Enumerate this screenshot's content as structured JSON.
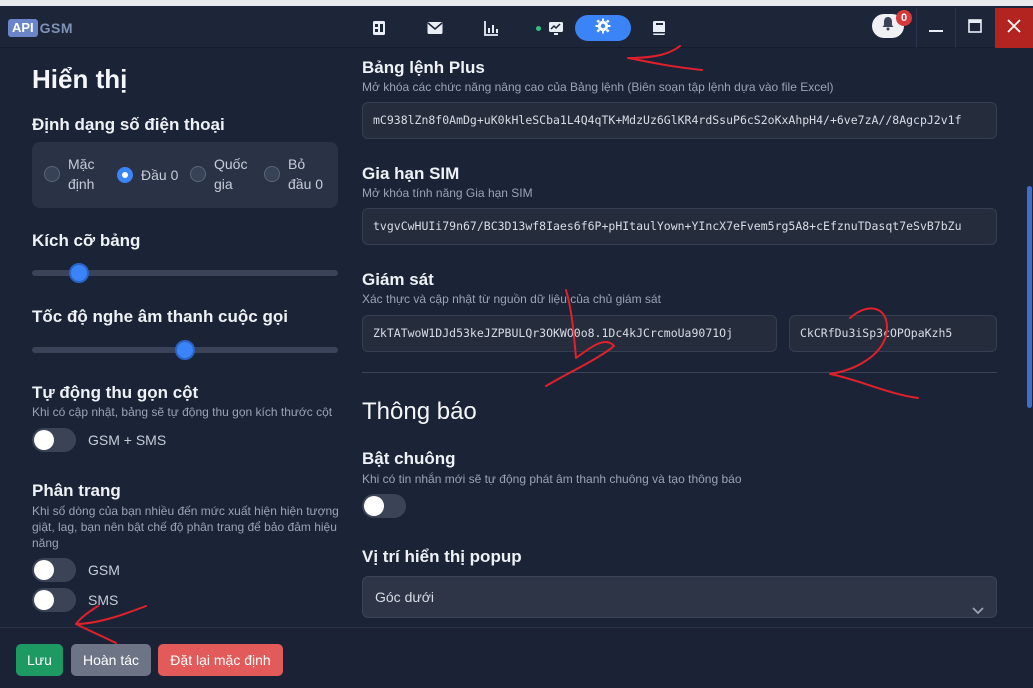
{
  "app": {
    "logo_api": "API",
    "logo_gsm": "GSM",
    "notification_count": "0"
  },
  "nav_icons": [
    "book-icon",
    "mail-icon",
    "chart-icon",
    "monitor-icon",
    "gear-icon",
    "notebook-icon"
  ],
  "sidebar": {
    "title": "Hiển thị",
    "phone_format": {
      "label": "Định dạng số điện thoại",
      "options": [
        {
          "line1": "Mặc",
          "line2": "định"
        },
        {
          "line1": "Đầu 0",
          "line2": ""
        },
        {
          "line1": "Quốc",
          "line2": "gia"
        },
        {
          "line1": "Bỏ",
          "line2": "đầu 0"
        }
      ],
      "selected": "Đầu 0"
    },
    "table_size": {
      "label": "Kích cỡ bảng",
      "level": 0.155
    },
    "call_speed": {
      "label": "Tốc độ nghe âm thanh cuộc gọi",
      "level": 0.5
    },
    "auto_collapse": {
      "label": "Tự động thu gọn cột",
      "desc": "Khi có cập nhật, bảng sẽ tự động thu gọn kích thước cột",
      "toggle_label": "GSM + SMS",
      "on": false
    },
    "pagination": {
      "label": "Phân trang",
      "desc1": "Khi số dòng của bạn nhiều đến mức xuất hiện hiện tượng",
      "desc2": "giật, lag, bạn nên bật chế độ phân trang để bảo đảm hiệu",
      "desc3": "năng",
      "toggles": [
        {
          "label": "GSM",
          "on": false
        },
        {
          "label": "SMS",
          "on": false
        }
      ]
    }
  },
  "main": {
    "command_plus": {
      "title": "Bảng lệnh Plus",
      "desc": "Mở khóa các chức năng nâng cao của Bảng lệnh (Biên soạn tập lệnh dựa vào file Excel)",
      "key": "mC938lZn8f0AmDg+uK0kHleSCba1L4Q4qTK+MdzUz6GlKR4rdSsuP6cS2oKxAhpH4/+6ve7zA//8AgcpJ2v1f"
    },
    "sim_extension": {
      "title": "Gia hạn SIM",
      "desc": "Mở khóa tính năng Gia hạn SIM",
      "key": "tvgvCwHUIi79n67/BC3D13wf8Iaes6f6P+pHItaulYown+YIncX7eFvem5rg5A8+cEfznuTDasqt7eSvB7bZu"
    },
    "monitoring": {
      "title": "Giám sát",
      "desc": "Xác thực và cập nhật từ nguồn dữ liệu của chủ giám sát",
      "key1": "ZkTATwoW1DJd53keJZPBULQr3OKWO0o8.1Dc4kJCrcmoUa9071Oj",
      "key2": "CkCRfDu3iSp3cOPOpaKzh5"
    },
    "notifications": {
      "title": "Thông báo",
      "bell": {
        "title": "Bật chuông",
        "desc": "Khi có tin nhắn mới sẽ tự động phát âm thanh chuông và tạo thông báo",
        "on": false
      },
      "popup": {
        "title": "Vị trí hiển thị popup",
        "value": "Góc dưới"
      }
    }
  },
  "footer": {
    "save": "Lưu",
    "undo": "Hoàn tác",
    "reset": "Đặt lại mặc định"
  },
  "colors": {
    "accent": "#3a84f7",
    "save": "#1d9a62",
    "reset": "#e25a5a",
    "annotation": "#e0202a"
  }
}
